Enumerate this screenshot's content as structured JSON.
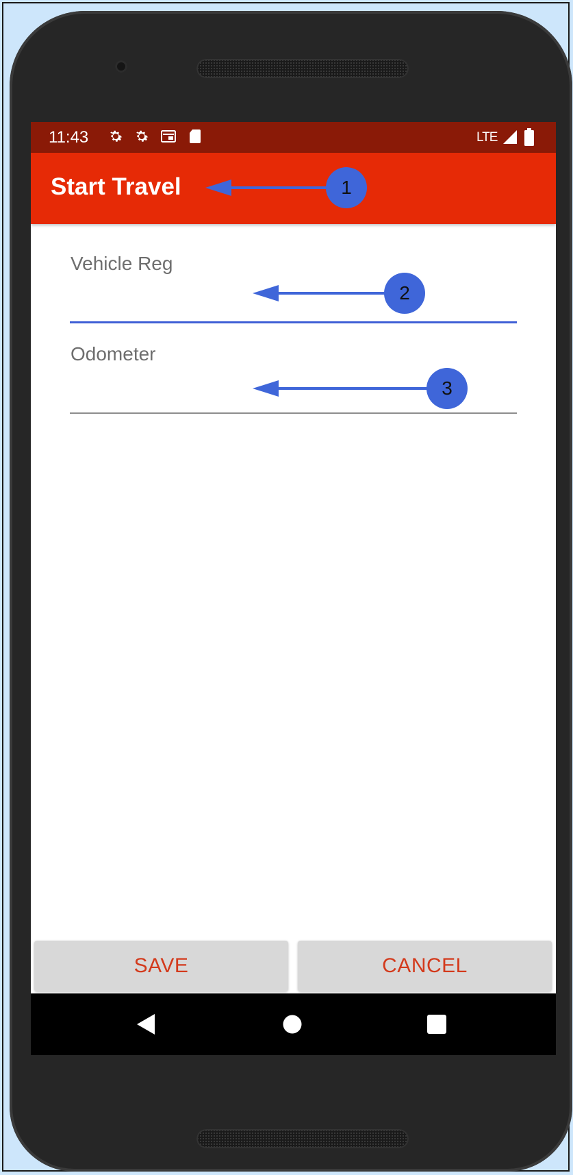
{
  "status_bar": {
    "time": "11:43",
    "network": "LTE",
    "icons": [
      "settings-icon",
      "settings-icon",
      "cast-icon",
      "sd-card-icon",
      "signal-icon",
      "battery-icon"
    ]
  },
  "app_bar": {
    "title": "Start Travel"
  },
  "form": {
    "vehicle_reg": {
      "label": "Vehicle Reg",
      "value": ""
    },
    "odometer": {
      "label": "Odometer",
      "value": ""
    }
  },
  "buttons": {
    "save": "SAVE",
    "cancel": "CANCEL"
  },
  "annotations": {
    "callout_1": "1",
    "callout_2": "2",
    "callout_3": "3"
  },
  "colors": {
    "status_bar": "#8a1a07",
    "app_bar": "#e62a06",
    "accent": "#3f5fd6",
    "button_text": "#d33a1c",
    "annotation": "#3f66d9"
  },
  "nav_bar": {
    "icons": [
      "back-icon",
      "home-icon",
      "recents-icon"
    ]
  }
}
